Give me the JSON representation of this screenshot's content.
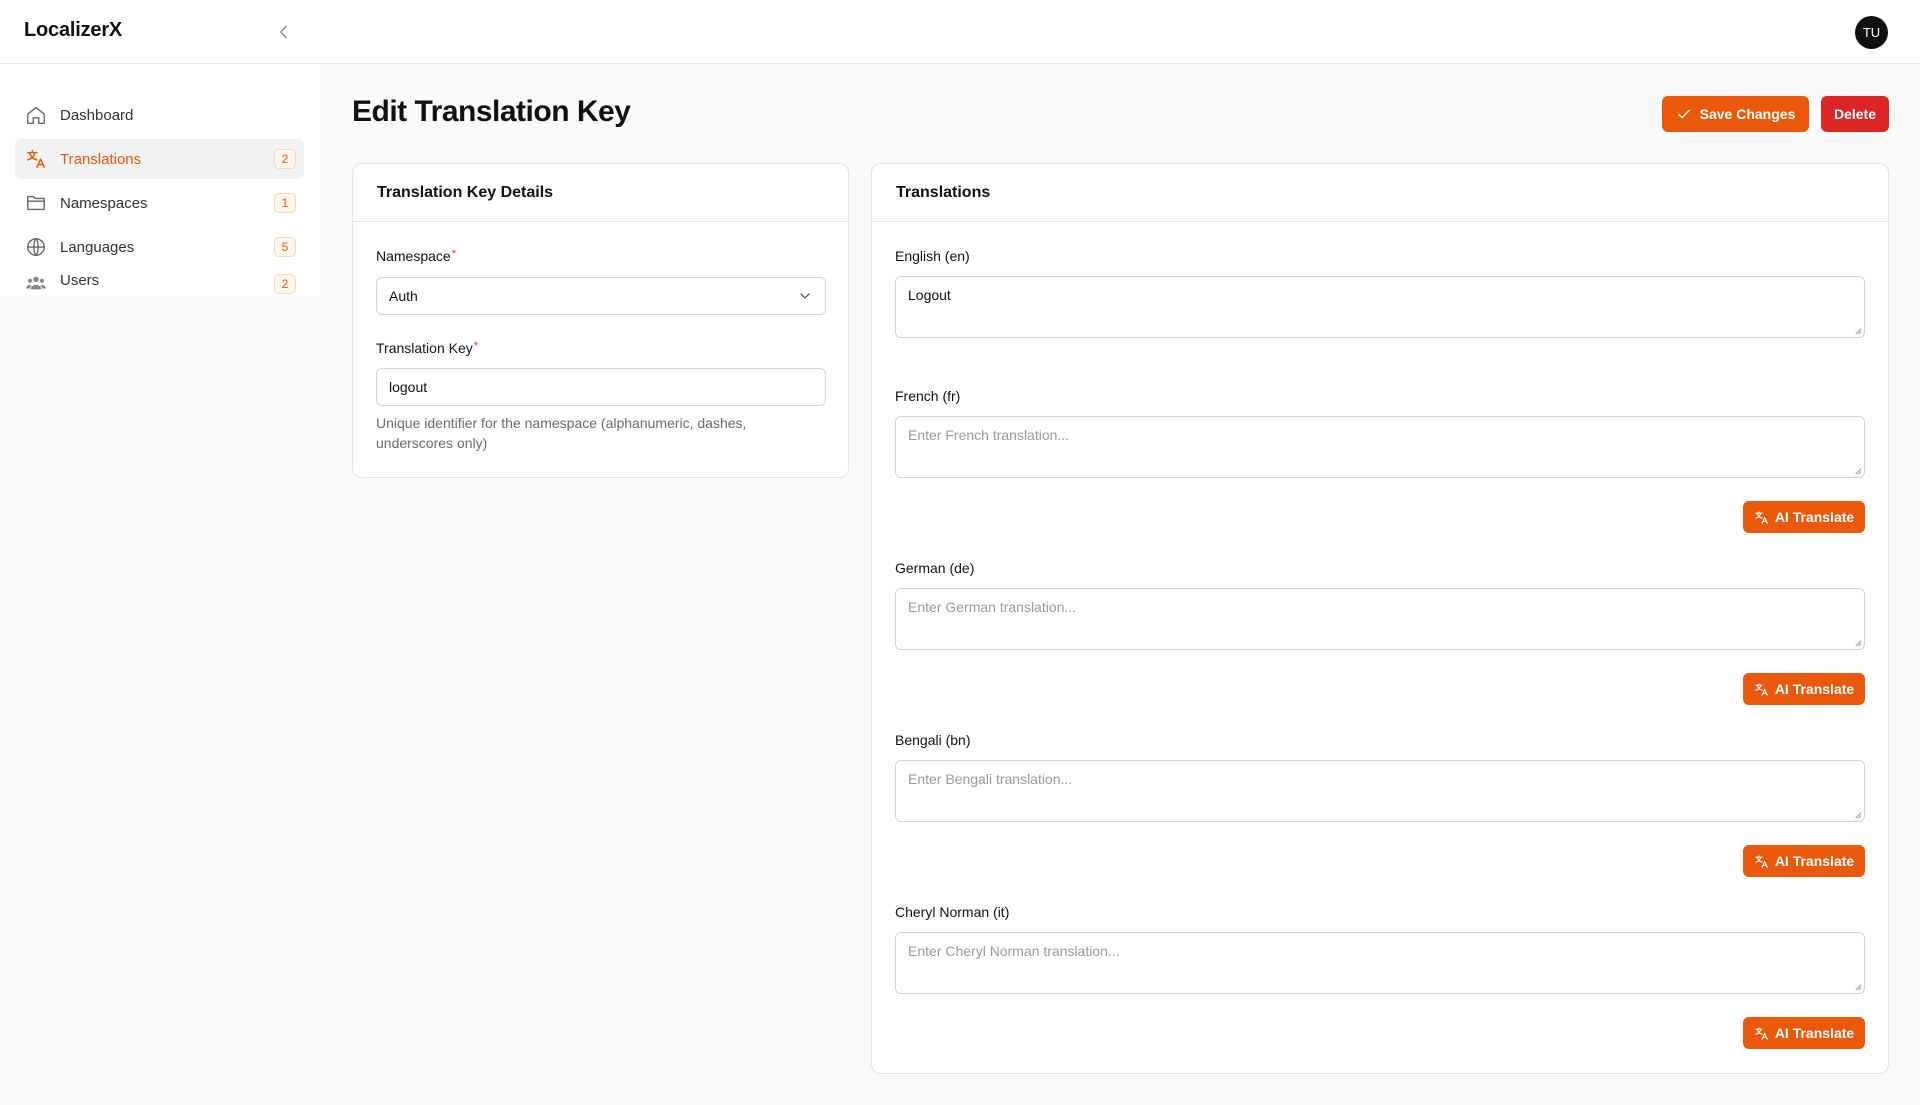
{
  "app": {
    "brand": "LocalizerX",
    "avatar_initials": "TU"
  },
  "sidebar": {
    "items": [
      {
        "label": "Dashboard",
        "icon": "home-icon"
      },
      {
        "label": "Translations",
        "icon": "translate-icon",
        "badge": "2",
        "active": true
      },
      {
        "label": "Namespaces",
        "icon": "folder-icon",
        "badge": "1"
      },
      {
        "label": "Languages",
        "icon": "globe-icon",
        "badge": "5"
      },
      {
        "label": "Users",
        "icon": "users-icon",
        "badge": "2"
      }
    ]
  },
  "page": {
    "title": "Edit Translation Key",
    "save_label": "Save Changes",
    "delete_label": "Delete"
  },
  "details": {
    "title": "Translation Key Details",
    "namespace_label": "Namespace",
    "namespace_value": "Auth",
    "key_label": "Translation Key",
    "key_value": "logout",
    "help": "Unique identifier for the namespace (alphanumeric, dashes, underscores only)",
    "required_mark": "*"
  },
  "translations": {
    "title": "Translations",
    "ai_label": "AI Translate",
    "languages": [
      {
        "label": "English (en)",
        "value": "Logout",
        "placeholder": ""
      },
      {
        "label": "French (fr)",
        "value": "",
        "placeholder": "Enter French translation..."
      },
      {
        "label": "German (de)",
        "value": "",
        "placeholder": "Enter German translation..."
      },
      {
        "label": "Bengali (bn)",
        "value": "",
        "placeholder": "Enter Bengali translation..."
      },
      {
        "label": "Cheryl Norman (it)",
        "value": "",
        "placeholder": "Enter Cheryl Norman translation..."
      }
    ]
  },
  "colors": {
    "accent": "#ea580c",
    "danger": "#dc2626"
  }
}
